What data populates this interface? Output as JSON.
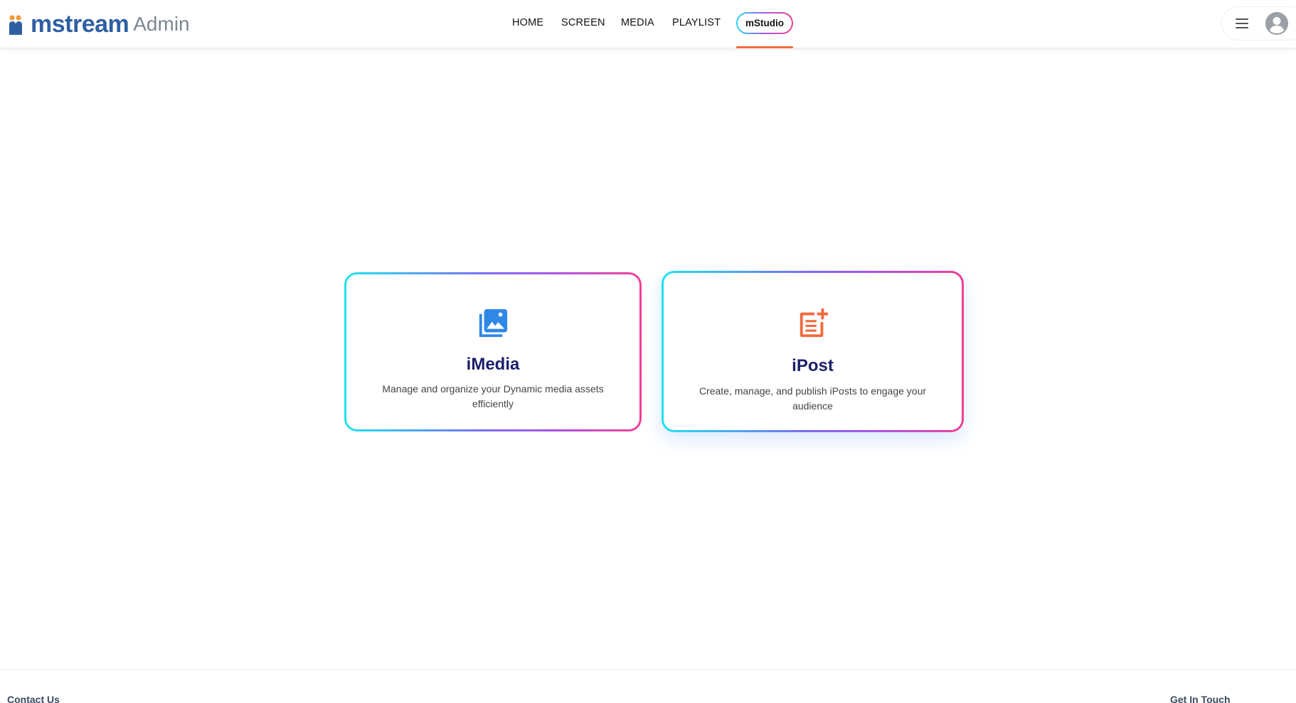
{
  "header": {
    "logo": {
      "brand": "mstream",
      "suffix": "Admin",
      "icon": "mstream-people-logo-icon",
      "colors": {
        "blue": "#2f5fa3",
        "orange": "#f29a3a",
        "grey": "#7b8693"
      }
    },
    "nav": {
      "items": [
        {
          "label": "HOME"
        },
        {
          "label": "SCREEN"
        },
        {
          "label": "MEDIA"
        },
        {
          "label": "PLAYLIST"
        }
      ],
      "active": {
        "label": "mStudio"
      },
      "active_color": "#f26a3d"
    },
    "menu_icon": "hamburger-icon",
    "avatar_icon": "user-avatar-icon"
  },
  "cards": [
    {
      "title": "iMedia",
      "description": "Manage and organize your Dynamic media assets efficiently",
      "icon": "photo-library-icon",
      "icon_color": "#2f88e6"
    },
    {
      "title": "iPost",
      "description": "Create, manage, and publish iPosts to engage your audience",
      "icon": "post-add-icon",
      "icon_color": "#f26a3d"
    }
  ],
  "card_border_gradient": [
    "#1ee3f2",
    "#7c6cf2",
    "#a853e6",
    "#f23f95"
  ],
  "footer": {
    "left": "Contact Us",
    "right": "Get In Touch"
  }
}
